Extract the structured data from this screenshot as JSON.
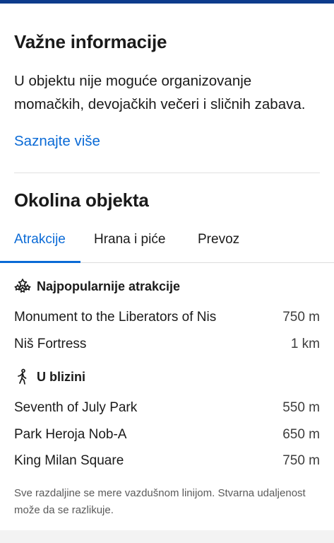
{
  "important": {
    "title": "Važne informacije",
    "text": "U objektu nije moguće organizovanje momačkih, devojačkih večeri i sličnih zabava.",
    "link": "Saznajte više"
  },
  "surroundings": {
    "title": "Okolina objekta",
    "tabs": [
      {
        "label": "Atrakcije",
        "active": true
      },
      {
        "label": "Hrana i piće",
        "active": false
      },
      {
        "label": "Prevoz",
        "active": false
      }
    ],
    "groups": [
      {
        "icon": "attractions-icon",
        "title": "Najpopularnije atrakcije",
        "items": [
          {
            "name": "Monument to the Liberators of Nis",
            "distance": "750 m"
          },
          {
            "name": "Niš Fortress",
            "distance": "1 km"
          }
        ]
      },
      {
        "icon": "walking-person-icon",
        "title": "U blizini",
        "items": [
          {
            "name": "Seventh of July Park",
            "distance": "550 m"
          },
          {
            "name": "Park Heroja Nob-A",
            "distance": "650 m"
          },
          {
            "name": "King Milan Square",
            "distance": "750 m"
          }
        ]
      }
    ],
    "footnote": "Sve razdaljine se mere vazdušnom linijom. Stvarna udaljenost može da se razlikuje."
  },
  "colors": {
    "accent": "#0a6ad6",
    "top_bar": "#0d3b8c",
    "text": "#1a1a1a",
    "muted": "#5a5a5a"
  }
}
